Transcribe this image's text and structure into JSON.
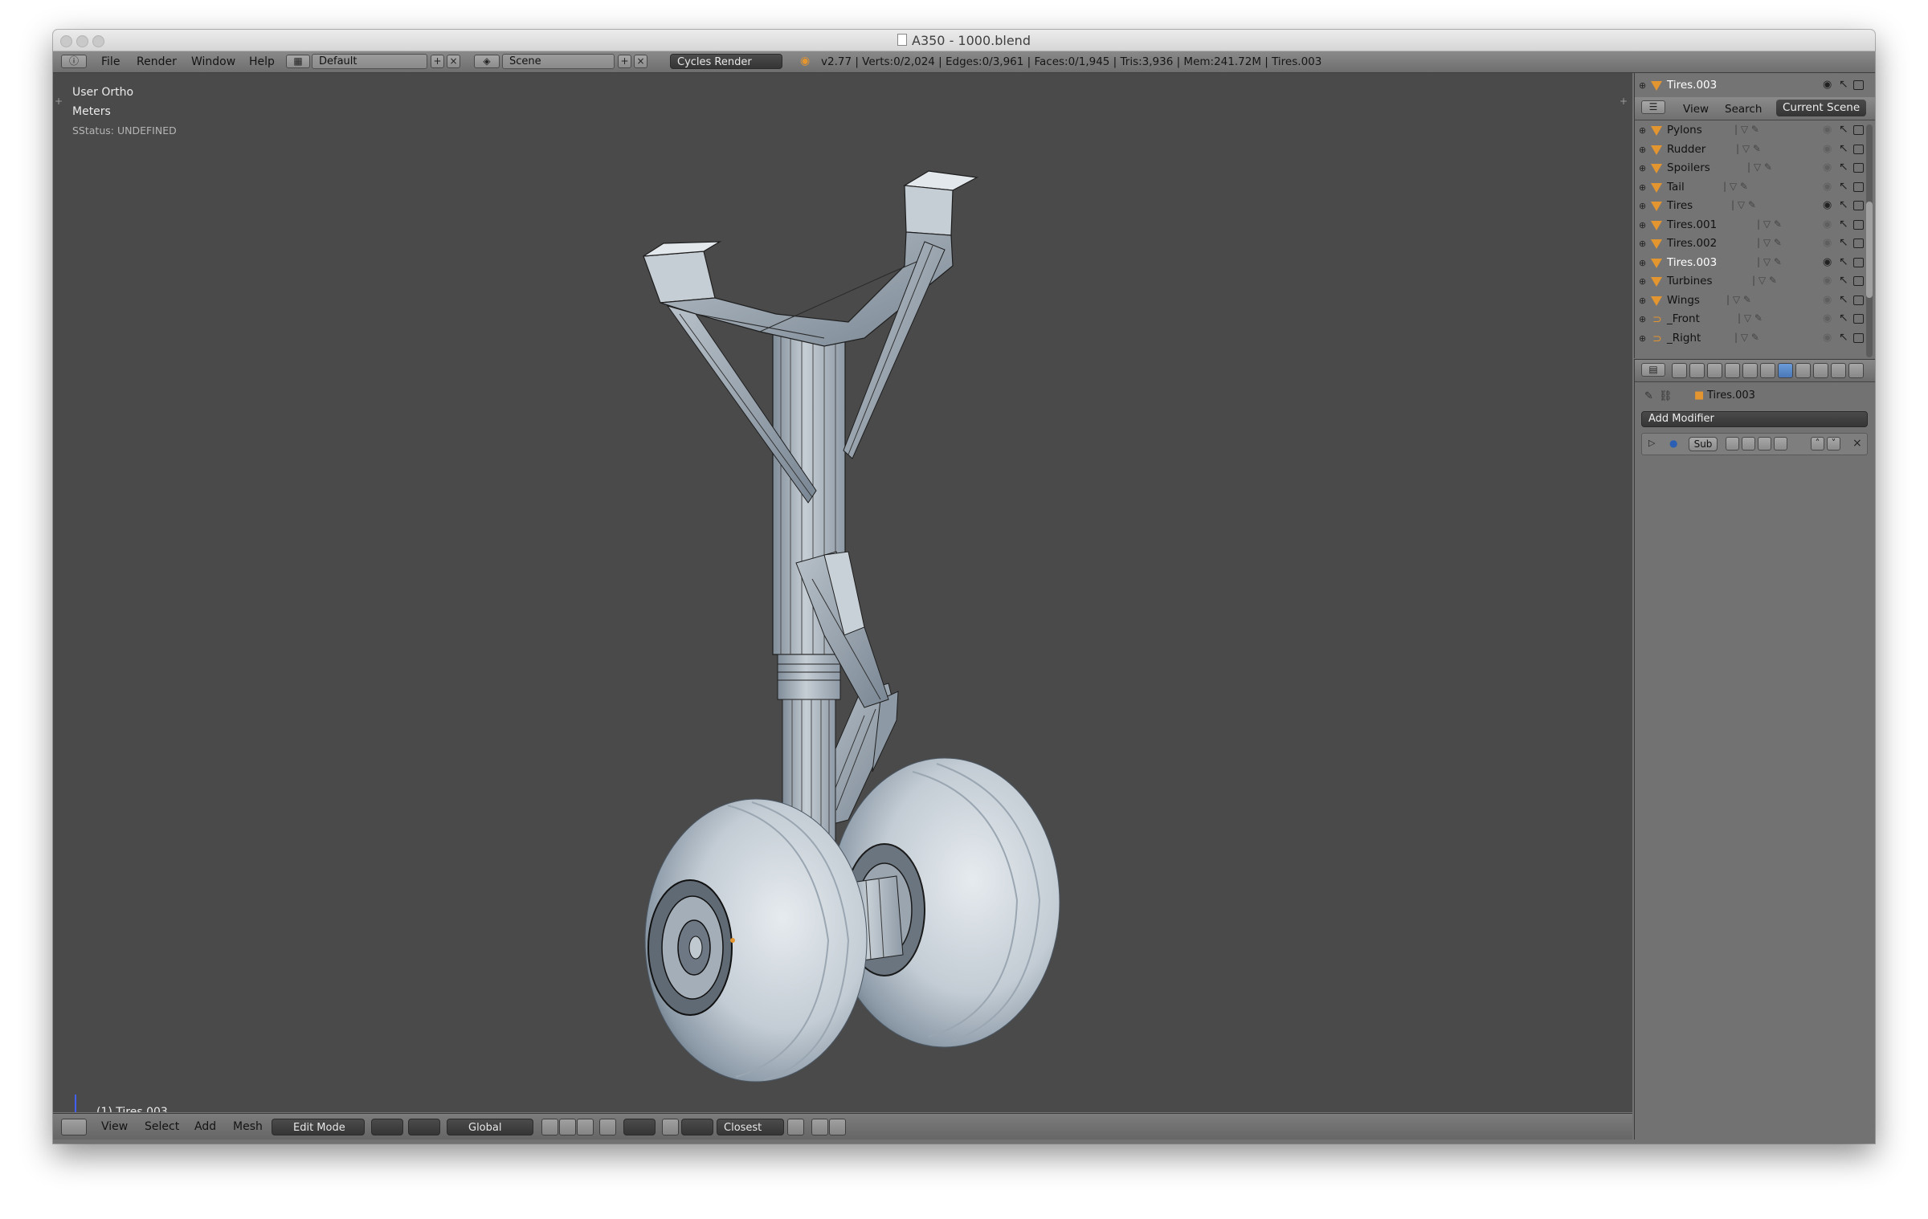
{
  "window": {
    "title": "A350 - 1000.blend"
  },
  "topbar": {
    "menus": [
      "File",
      "Render",
      "Window",
      "Help"
    ],
    "layout": "Default",
    "scene": "Scene",
    "engine": "Cycles Render",
    "stats": "v2.77 | Verts:0/2,024 | Edges:0/3,961 | Faces:0/1,945 | Tris:3,936 | Mem:241.72M | Tires.003"
  },
  "viewport": {
    "view_name": "User Ortho",
    "units": "Meters",
    "status": "SStatus: UNDEFINED",
    "object_label": "(1) Tires.003"
  },
  "bottombar": {
    "menus": [
      "View",
      "Select",
      "Add",
      "Mesh"
    ],
    "mode": "Edit Mode",
    "orientation": "Global",
    "snap": "Closest"
  },
  "outliner": {
    "top_item": "Tires.003",
    "tabs": [
      "View",
      "Search"
    ],
    "active_tab": "Current Scene",
    "items": [
      {
        "name": "Pylons",
        "type": "mesh"
      },
      {
        "name": "Rudder",
        "type": "mesh"
      },
      {
        "name": "Spoilers",
        "type": "mesh"
      },
      {
        "name": "Tail",
        "type": "mesh"
      },
      {
        "name": "Tires",
        "type": "mesh"
      },
      {
        "name": "Tires.001",
        "type": "mesh"
      },
      {
        "name": "Tires.002",
        "type": "mesh"
      },
      {
        "name": "Tires.003",
        "type": "mesh"
      },
      {
        "name": "Turbines",
        "type": "mesh"
      },
      {
        "name": "Wings",
        "type": "mesh"
      },
      {
        "name": "_Front",
        "type": "camera"
      },
      {
        "name": "_Right",
        "type": "camera"
      }
    ]
  },
  "properties": {
    "breadcrumb": "Tires.003",
    "add_modifier": "Add Modifier",
    "modifier_name": "Sub"
  },
  "colors": {
    "viewport_bg": "#4a4a4a",
    "object_orange": "#e39530",
    "active_tab_blue": "#4a78b8"
  }
}
